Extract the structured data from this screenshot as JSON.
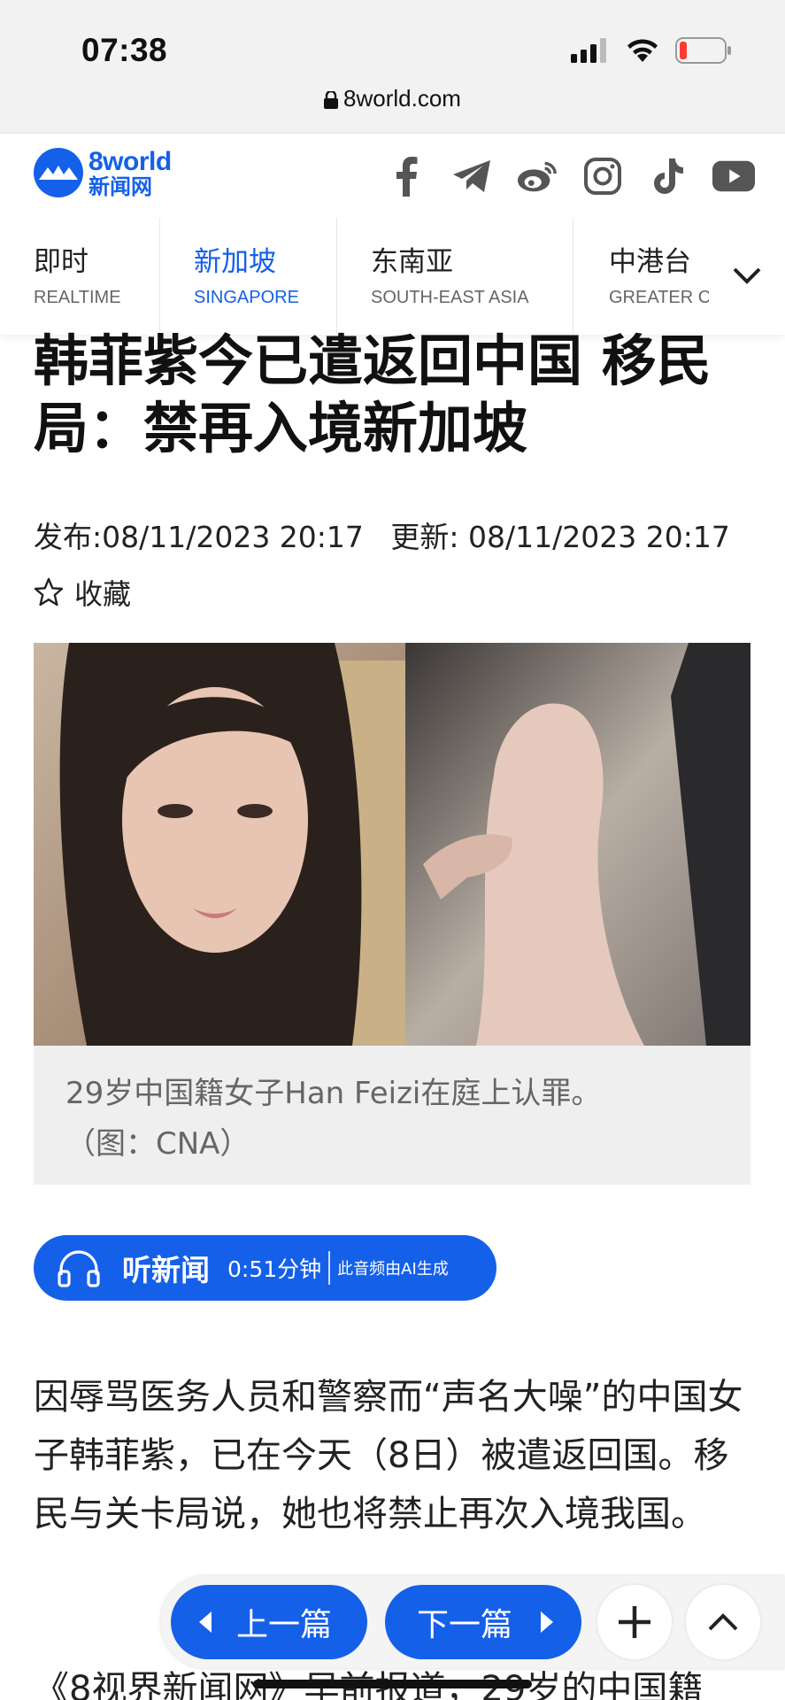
{
  "status_bar": {
    "time": "07:38",
    "url": "8world.com",
    "battery_color": "#ff3b30"
  },
  "header": {
    "logo_en": "8world",
    "logo_zh": "新闻网",
    "brand_color": "#1560e8",
    "socials": [
      "facebook-icon",
      "telegram-icon",
      "weibo-icon",
      "instagram-icon",
      "tiktok-icon",
      "youtube-icon"
    ]
  },
  "tabs": [
    {
      "zh": "即时",
      "en": "REALTIME",
      "active": false
    },
    {
      "zh": "新加坡",
      "en": "SINGAPORE",
      "active": true
    },
    {
      "zh": "东南亚",
      "en": "SOUTH-EAST ASIA",
      "active": false
    },
    {
      "zh": "中港台",
      "en": "GREATER C",
      "active": false
    }
  ],
  "article": {
    "headline": "韩菲紫今已遣返回中国 移民局：禁再入境新加坡",
    "published": "发布:08/11/2023 20:17",
    "updated": "更新: 08/11/2023 20:17",
    "bookmark_label": "收藏",
    "caption_line1": "29岁中国籍女子Han Feizi在庭上认罪。",
    "caption_line2": "（图：CNA）",
    "body_paragraph": "因辱骂医务人员和警察而“声名大噪”的中国女子韩菲紫，已在今天（8日）被遣返回国。移民与关卡局说，她也将禁止再次入境我国。",
    "next_paragraph_start": "《8视界新闻网》早前报道，29岁的中国籍"
  },
  "audio": {
    "label": "听新闻",
    "duration": "0:51分钟",
    "ai_note": "此音频由AI生成"
  },
  "bottom_nav": {
    "prev_label": "上一篇",
    "next_label": "下一篇"
  }
}
